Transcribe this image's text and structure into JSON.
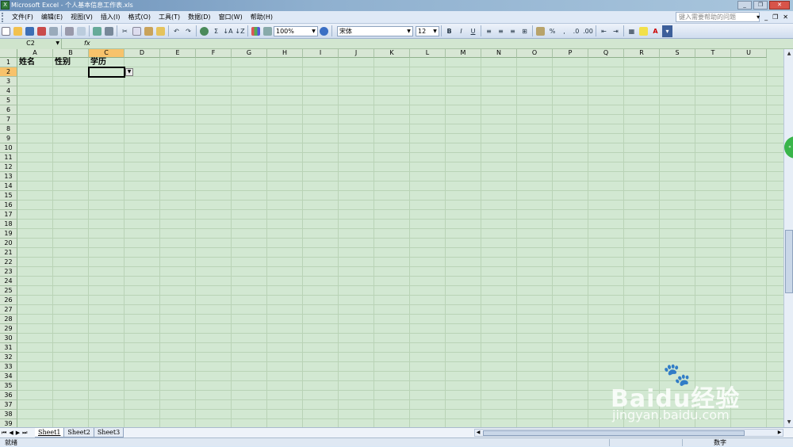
{
  "window": {
    "title": "Microsoft Excel - 个人基本信息工作表.xls",
    "app_icon": "excel-icon"
  },
  "menu": {
    "items": [
      "文件(F)",
      "编辑(E)",
      "视图(V)",
      "插入(I)",
      "格式(O)",
      "工具(T)",
      "数据(D)",
      "窗口(W)",
      "帮助(H)"
    ],
    "help_placeholder": "键入需要帮助的问题"
  },
  "toolbar": {
    "zoom": "100%",
    "font_name": "宋体",
    "font_size": "12",
    "sum_label": "Σ",
    "bold": "B",
    "italic": "I",
    "underline": "U",
    "percent": "%"
  },
  "formula_bar": {
    "name_box": "C2",
    "fx_label": "fx",
    "content": ""
  },
  "sheet": {
    "columns": [
      "A",
      "B",
      "C",
      "D",
      "E",
      "F",
      "G",
      "H",
      "I",
      "J",
      "K",
      "L",
      "M",
      "N",
      "O",
      "P",
      "Q",
      "R",
      "S",
      "T",
      "U"
    ],
    "selected_column": "C",
    "rows": [
      "1",
      "2",
      "3",
      "4",
      "5",
      "6",
      "7",
      "8",
      "9",
      "10",
      "11",
      "12",
      "13",
      "14",
      "15",
      "16",
      "17",
      "18",
      "19",
      "20",
      "21",
      "22",
      "23",
      "24",
      "25",
      "26",
      "27",
      "28",
      "29",
      "30",
      "31",
      "32",
      "33",
      "34",
      "35",
      "36",
      "37",
      "38",
      "39"
    ],
    "selected_row": "2",
    "active_cell": "C2",
    "cells": {
      "A1": "姓名",
      "B1": "性别",
      "C1": "学历"
    }
  },
  "tabs": [
    "Sheet1",
    "Sheet2",
    "Sheet3"
  ],
  "active_tab": "Sheet1",
  "status": {
    "left": "就绪",
    "right": "数字"
  },
  "watermark": {
    "brand": "Baidu经验",
    "site": "jingyan.baidu.com"
  },
  "colors": {
    "grid_bg": "#d2e8d2",
    "header_selected": "#f7c26b",
    "titlebar": "#6a8fb8"
  }
}
